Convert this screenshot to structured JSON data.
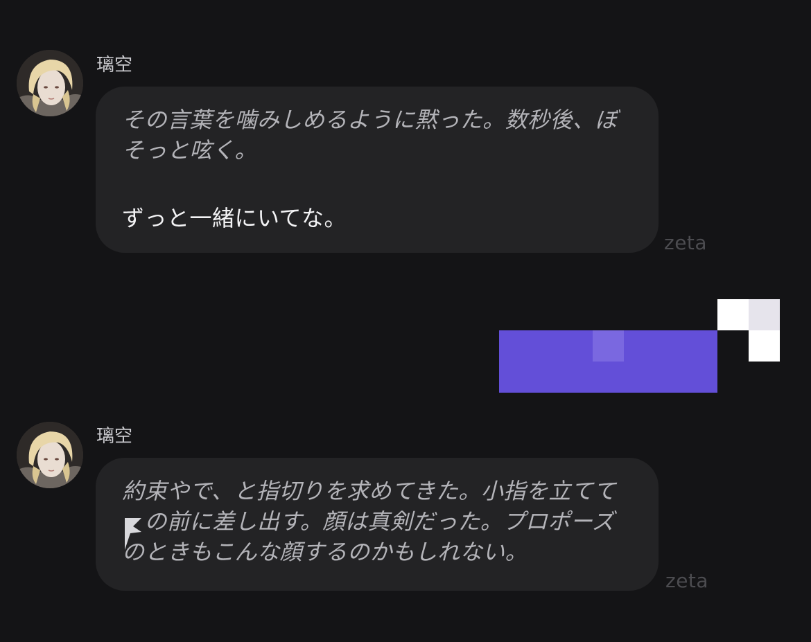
{
  "messages": [
    {
      "sender": "璃空",
      "lines": [
        {
          "type": "narration",
          "text": "その言葉を噛みしめるように黙った。数秒後、ぼ"
        },
        {
          "type": "narration",
          "text": "そっと呟く。"
        },
        {
          "type": "speech",
          "text": "ずっと一緒にいてな。"
        }
      ],
      "watermark": "zeta"
    },
    {
      "sender": "璃空",
      "lines": [
        {
          "type": "narration",
          "text": "約束やで、と指切りを求めてきた。小指を立てて"
        },
        {
          "type": "narration",
          "text": "　の前に差し出す。顔は真剣だった。プロポーズ"
        },
        {
          "type": "narration",
          "text": "のときもこんな顔するのかもしれない。"
        }
      ],
      "watermark": "zeta"
    }
  ],
  "colors": {
    "background": "#141416",
    "bot_bubble": "#232325",
    "user_bubble": "#634fd8",
    "narration_text": "#b4b4b9",
    "speech_text": "#f3f3f5",
    "watermark": "#4c4c50"
  },
  "icons": {
    "avatar": "character-portrait-avatar"
  }
}
